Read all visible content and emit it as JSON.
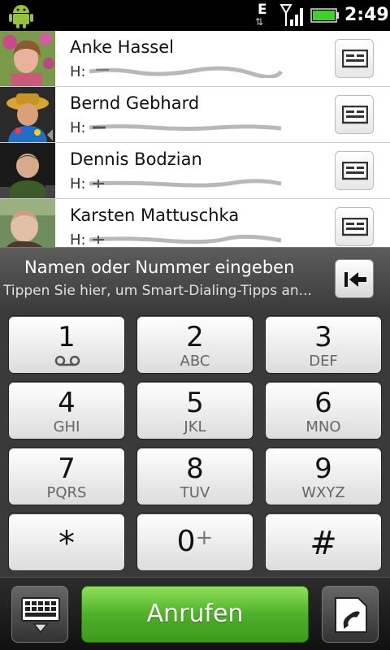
{
  "status_bar": {
    "network_type": "E",
    "network_arrows": "⇅",
    "time": "2:49",
    "icons": [
      "android-icon",
      "data-arrows-icon",
      "signal-icon",
      "battery-icon"
    ]
  },
  "contacts": [
    {
      "name": "Anke Hassel",
      "phone_label": "H:",
      "avatar_color": "#c97b8a"
    },
    {
      "name": "Bernd Gebhard",
      "phone_label": "H:",
      "avatar_color": "#d9a531"
    },
    {
      "name": "Dennis Bodzian",
      "phone_label": "H:",
      "avatar_color": "#3b3b3b"
    },
    {
      "name": "Karsten Mattuschka",
      "phone_label": "H:",
      "avatar_color": "#6f8d5f"
    }
  ],
  "input_bar": {
    "title": "Namen oder Nummer eingeben",
    "hint": "Tippen Sie hier, um Smart-Dialing-Tipps an..."
  },
  "keypad": {
    "keys": [
      {
        "digit": "1",
        "letters": ""
      },
      {
        "digit": "2",
        "letters": "ABC"
      },
      {
        "digit": "3",
        "letters": "DEF"
      },
      {
        "digit": "4",
        "letters": "GHI"
      },
      {
        "digit": "5",
        "letters": "JKL"
      },
      {
        "digit": "6",
        "letters": "MNO"
      },
      {
        "digit": "7",
        "letters": "PQRS"
      },
      {
        "digit": "8",
        "letters": "TUV"
      },
      {
        "digit": "9",
        "letters": "WXYZ"
      },
      {
        "digit": "*",
        "letters": ""
      },
      {
        "digit": "0",
        "letters": "+"
      },
      {
        "digit": "#",
        "letters": ""
      }
    ]
  },
  "bottom_bar": {
    "call_label": "Anrufen"
  },
  "colors": {
    "call_green": "#4fb02a",
    "status_bar_bg": "#000000",
    "battery_green": "#3fcf2f"
  }
}
